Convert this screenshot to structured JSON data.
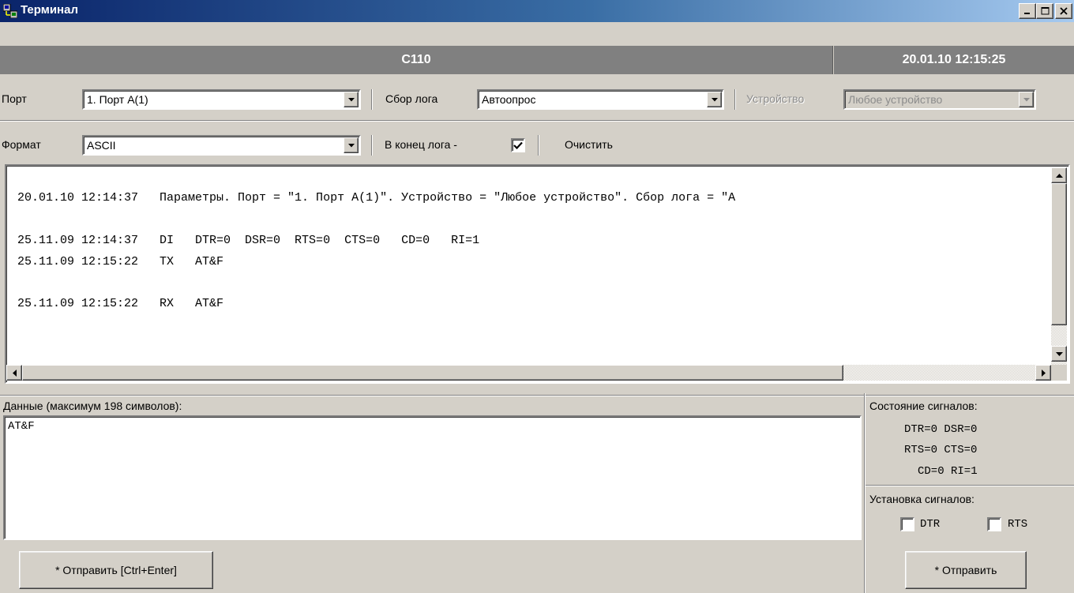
{
  "window": {
    "title": "Терминал",
    "icon": "network-terminal-icon",
    "controls": [
      "minimize-icon",
      "maximize-icon",
      "close-icon"
    ]
  },
  "header": {
    "device": "C110",
    "datetime": "20.01.10 12:15:25"
  },
  "row1": {
    "port_label": "Порт",
    "port_value": "1. Порт A(1)",
    "log_label": "Сбор лога",
    "log_value": "Автоопрос",
    "device_label": "Устройство",
    "device_value": "Любое устройство"
  },
  "row2": {
    "format_label": "Формат",
    "format_value": "ASCII",
    "tolog_label": "В конец лога -",
    "tolog_checked": true,
    "clear_label": "Очистить"
  },
  "log": {
    "lines": [
      "20.01.10 12:14:37   Параметры. Порт = \"1. Порт A(1)\". Устройство = \"Любое устройство\". Сбор лога = \"А",
      "25.11.09 12:14:37   DI   DTR=0  DSR=0  RTS=0  CTS=0   CD=0   RI=1",
      "25.11.09 12:15:22   TX   AT&F",
      "25.11.09 12:15:22   RX   AT&F"
    ]
  },
  "data": {
    "label": "Данные (максимум 198 символов):",
    "value": "AT&F",
    "send_label": "* Отправить [Ctrl+Enter]"
  },
  "signals": {
    "state_label": "Состояние сигналов:",
    "state_lines": [
      "DTR=0  DSR=0",
      "RTS=0  CTS=0",
      "CD=0   RI=1"
    ],
    "set_label": "Установка сигналов:",
    "dtr_label": "DTR",
    "rts_label": "RTS",
    "send_label": "* Отправить"
  }
}
